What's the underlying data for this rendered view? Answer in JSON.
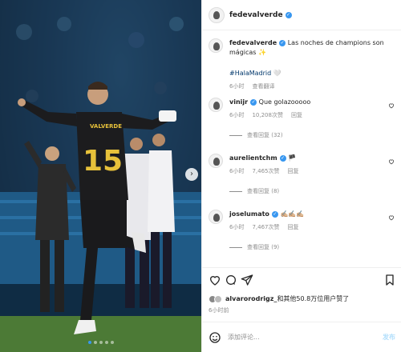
{
  "post": {
    "author": "fedevalverde",
    "caption": "Las noches de champions son mágicas",
    "caption_emoji": "✨",
    "hashtag": "#HalaMadrid",
    "hashtag_emoji": "🤍",
    "time": "6小时",
    "translate": "查看翻译",
    "jersey_name": "VALVERDE",
    "jersey_number": "15"
  },
  "comments": [
    {
      "user": "vinijr",
      "text": "Que golazooooo",
      "time": "6小时",
      "likes": "10,208次赞",
      "reply": "回复",
      "view_replies": "查看回复 (32)"
    },
    {
      "user": "aurelientchm",
      "text": "🏴",
      "time": "6小时",
      "likes": "7,465次赞",
      "reply": "回复",
      "view_replies": "查看回复 (8)"
    },
    {
      "user": "joselumato",
      "text": "✍🏼✍🏼✍🏼",
      "time": "6小时",
      "likes": "7,467次赞",
      "reply": "回复",
      "view_replies": "查看回复 (9)"
    }
  ],
  "likes": {
    "user": "alvarorodrigz_",
    "rest": "和其他50.8万位用户赞了"
  },
  "footer_time": "6小时前",
  "comment_box": {
    "placeholder": "添加评论...",
    "post": "发布"
  },
  "carousel": {
    "next_glyph": "›",
    "total": 5,
    "active": 1
  },
  "colors": {
    "accent": "#3897f0",
    "hashtag": "#00376b",
    "muted": "#8e8e8e"
  }
}
